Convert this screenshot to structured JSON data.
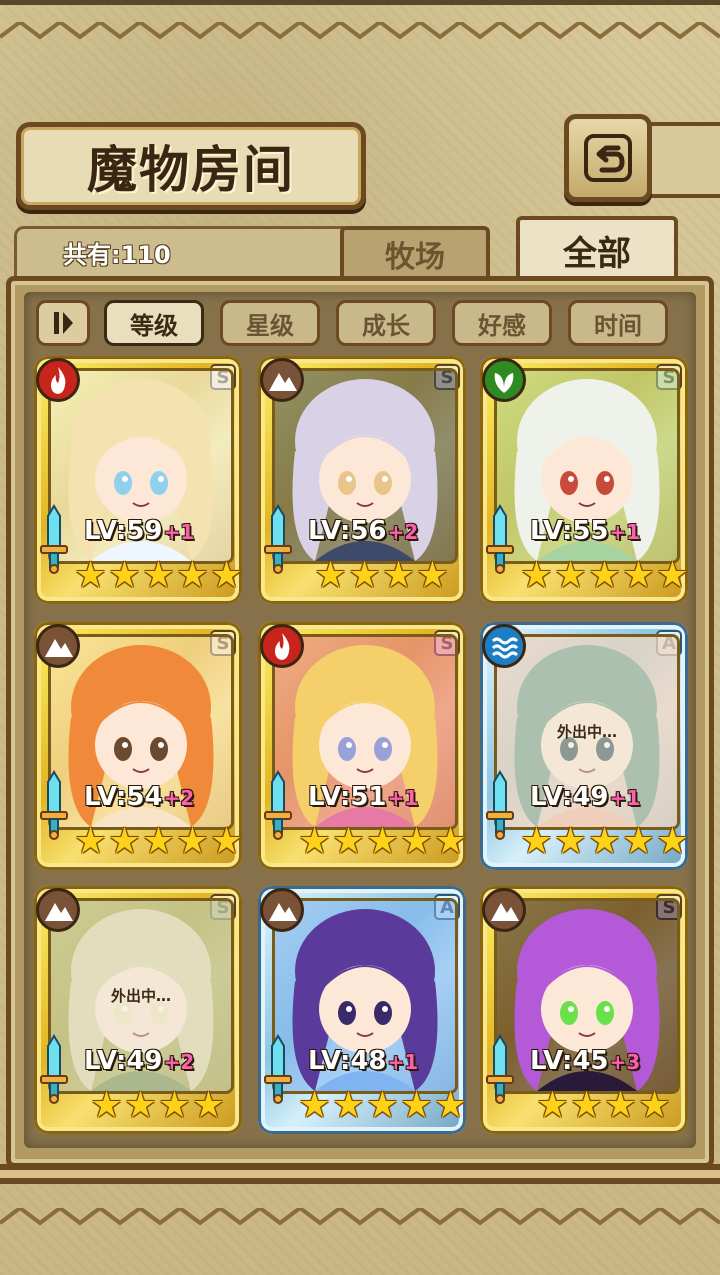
{
  "header": {
    "title": "魔物房间",
    "back_icon": "back-arrow-icon"
  },
  "tabs": {
    "count_label": "共有:110",
    "ranch": "牧场",
    "all": "全部"
  },
  "sort": {
    "toggle_icon": "sort-direction-icon",
    "buttons": [
      "等级",
      "星级",
      "成长",
      "好感",
      "时间"
    ],
    "active": "等级"
  },
  "colors": {
    "fire": "#c8241c",
    "earth": "#7a5238",
    "nature": "#2f8a22",
    "water": "#1c7ec4",
    "gold_frame": "#e2b520",
    "silver_frame": "#8ec6e0",
    "level_plus": "#ff5fb0"
  },
  "monsters": [
    {
      "element": "fire",
      "grade": "S",
      "frame": "gold",
      "level": "LV:59",
      "plus": "+1",
      "stars": 5,
      "status": "",
      "palette": [
        "#f4e3b0",
        "#eef6ff",
        "#8fd0ec"
      ]
    },
    {
      "element": "earth",
      "grade": "S",
      "frame": "gold",
      "level": "LV:56",
      "plus": "+2",
      "stars": 4,
      "status": "",
      "palette": [
        "#d9d2e6",
        "#3d4a6a",
        "#e8c68a"
      ]
    },
    {
      "element": "nature",
      "grade": "S",
      "frame": "gold",
      "level": "LV:55",
      "plus": "+1",
      "stars": 5,
      "status": "",
      "palette": [
        "#eef2ea",
        "#a7d3a0",
        "#c84a3a"
      ]
    },
    {
      "element": "earth",
      "grade": "S",
      "frame": "gold",
      "level": "LV:54",
      "plus": "+2",
      "stars": 5,
      "status": "",
      "palette": [
        "#f08a3a",
        "#f8e4c8",
        "#6a4a30"
      ]
    },
    {
      "element": "fire",
      "grade": "S",
      "frame": "gold",
      "level": "LV:51",
      "plus": "+1",
      "stars": 5,
      "status": "",
      "palette": [
        "#f4cf6a",
        "#e77aa4",
        "#9aa0d8"
      ]
    },
    {
      "element": "water",
      "grade": "A",
      "frame": "silver",
      "level": "LV:49",
      "plus": "+1",
      "stars": 5,
      "status": "外出中…",
      "palette": [
        "#6a9a8a",
        "#f2b8a0",
        "#2f4a58"
      ]
    },
    {
      "element": "earth",
      "grade": "S",
      "frame": "gold",
      "level": "LV:49",
      "plus": "+2",
      "stars": 4,
      "status": "外出中…",
      "palette": [
        "#d8d4a8",
        "#6a8a4a",
        "#f0e6c0"
      ]
    },
    {
      "element": "earth",
      "grade": "A",
      "frame": "silver",
      "level": "LV:48",
      "plus": "+1",
      "stars": 5,
      "status": "",
      "palette": [
        "#5a3a9a",
        "#7fb4f0",
        "#3a2a6a"
      ]
    },
    {
      "element": "earth",
      "grade": "S",
      "frame": "gold",
      "level": "LV:45",
      "plus": "+3",
      "stars": 4,
      "status": "",
      "palette": [
        "#b45ad8",
        "#2a1a3a",
        "#6ae04a"
      ]
    }
  ]
}
